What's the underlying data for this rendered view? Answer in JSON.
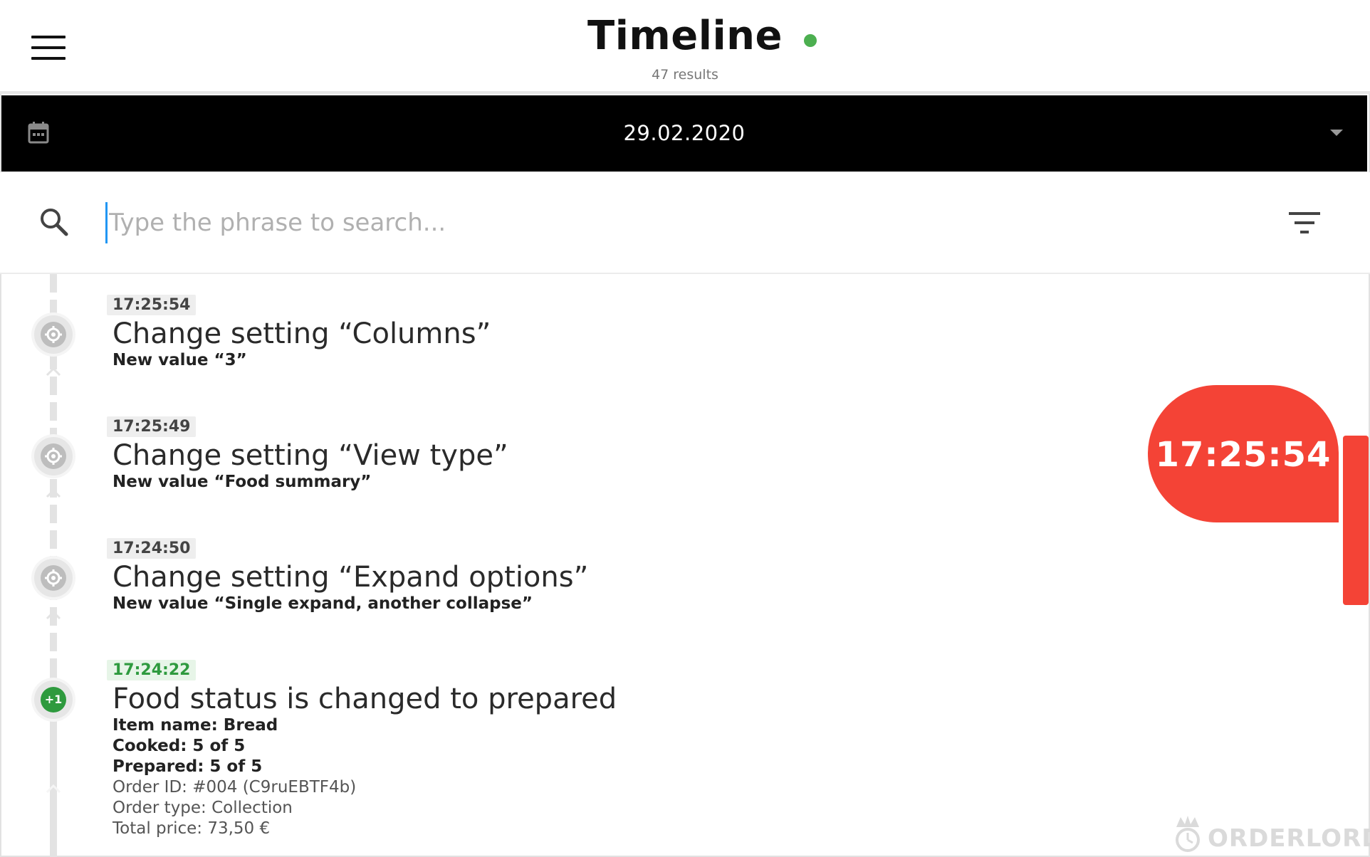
{
  "header": {
    "title": "Timeline",
    "results": "47 results",
    "status_color": "#4caf50",
    "menu_icon": "hamburger-menu-icon"
  },
  "datebar": {
    "date": "29.02.2020",
    "calendar_icon": "calendar-icon",
    "dropdown_icon": "dropdown-arrow-icon"
  },
  "search": {
    "placeholder": "Type the phrase to search...",
    "value": "",
    "search_icon": "search-icon",
    "filter_icon": "filter-icon"
  },
  "entries": [
    {
      "time": "17:25:54",
      "title": "Change setting “Columns”",
      "subtitle": "New value “3”",
      "icon": "gear-icon"
    },
    {
      "time": "17:25:49",
      "title": "Change setting “View type”",
      "subtitle": "New value “Food summary”",
      "icon": "gear-icon"
    },
    {
      "time": "17:24:50",
      "title": "Change setting “Expand options”",
      "subtitle": "New value “Single expand, another collapse”",
      "icon": "gear-icon"
    },
    {
      "time": "17:24:22",
      "title": "Food status is changed to prepared",
      "badge": "+1",
      "details_bold": [
        "Item name: Bread",
        "Cooked: 5 of 5",
        "Prepared: 5 of 5"
      ],
      "details": [
        "Order ID: #004 (C9ruEBTF4b)",
        "Order type: Collection",
        "Total price: 73,50 €"
      ]
    }
  ],
  "scroll_bubble": {
    "time": "17:25:54",
    "color": "#f44336"
  },
  "logo": {
    "text": "ORDERLORD"
  },
  "colors": {
    "accent_red": "#f44336",
    "accent_green": "#2e9a3e",
    "datebar_bg": "#000000"
  }
}
